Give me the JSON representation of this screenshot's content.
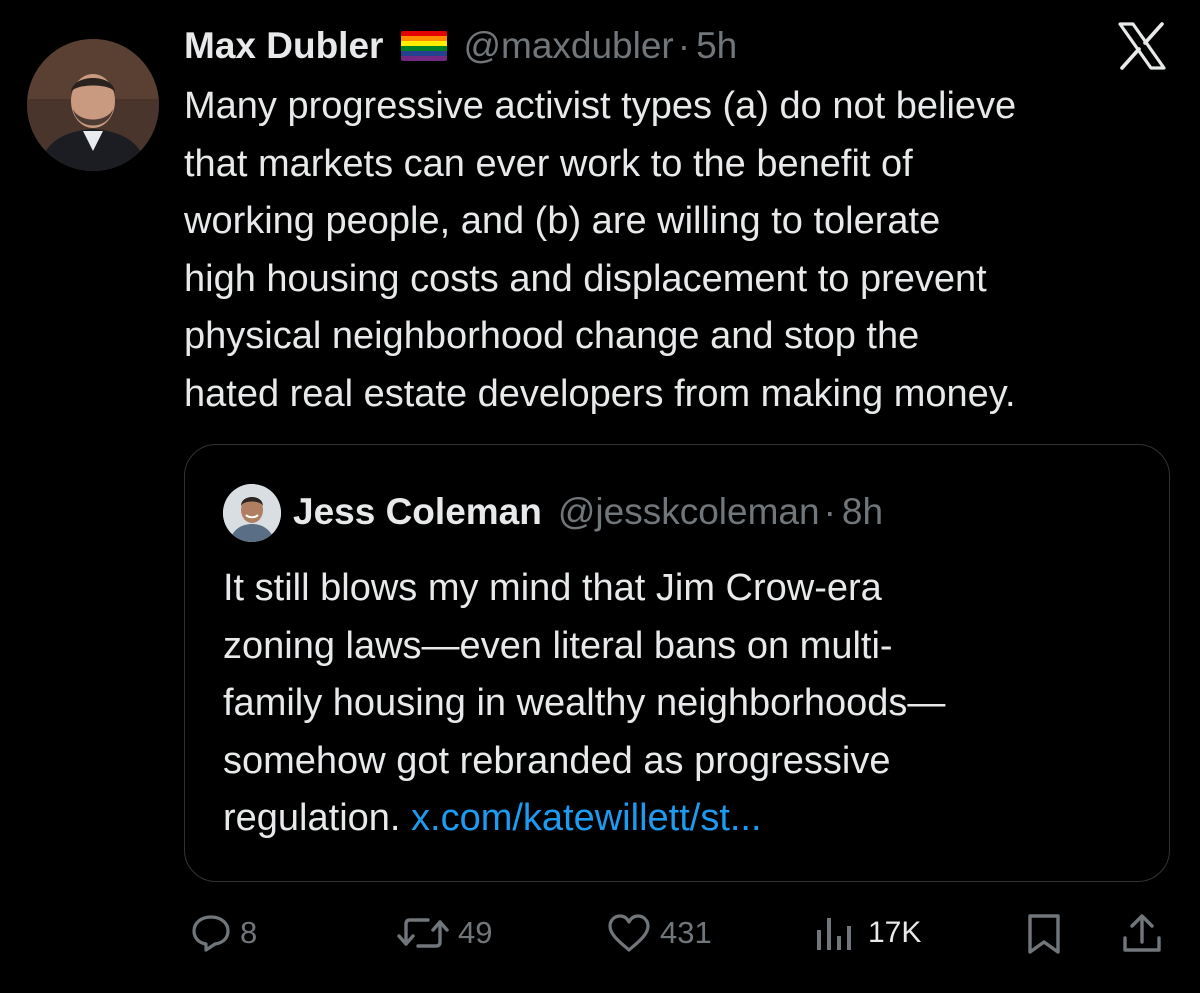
{
  "tweet": {
    "author_name": "Max Dubler",
    "author_handle": "@maxdubler",
    "separator": "·",
    "time": "5h",
    "lines": [
      "Many progressive activist types (a) do not believe",
      "that markets can ever work to the benefit of",
      "working people, and (b) are willing to tolerate",
      "high housing costs and displacement to prevent",
      "physical neighborhood change and stop the",
      "hated real estate developers from making money."
    ]
  },
  "quote": {
    "author_name": "Jess Coleman",
    "author_handle": "@jesskcoleman",
    "separator": "·",
    "time": "8h",
    "lines": [
      "It still blows my mind that Jim Crow-era",
      "zoning laws—even literal bans on multi-",
      "family housing in wealthy neighborhoods—",
      "somehow got rebranded as progressive"
    ],
    "last_line_text": "regulation. ",
    "link": "x.com/katewillett/st..."
  },
  "actions": {
    "replies": "8",
    "reposts": "49",
    "likes": "431",
    "views": "17K"
  },
  "icons": {
    "logo": "x-logo-icon",
    "reply": "reply-icon",
    "repost": "repost-icon",
    "like": "heart-icon",
    "views": "views-icon",
    "bookmark": "bookmark-icon",
    "share": "share-icon",
    "flag": "rainbow-flag-icon"
  },
  "colors": {
    "background": "#000000",
    "text": "#e7e9ea",
    "muted": "#71767b",
    "link": "#1d9bf0",
    "border": "#2f3336"
  }
}
